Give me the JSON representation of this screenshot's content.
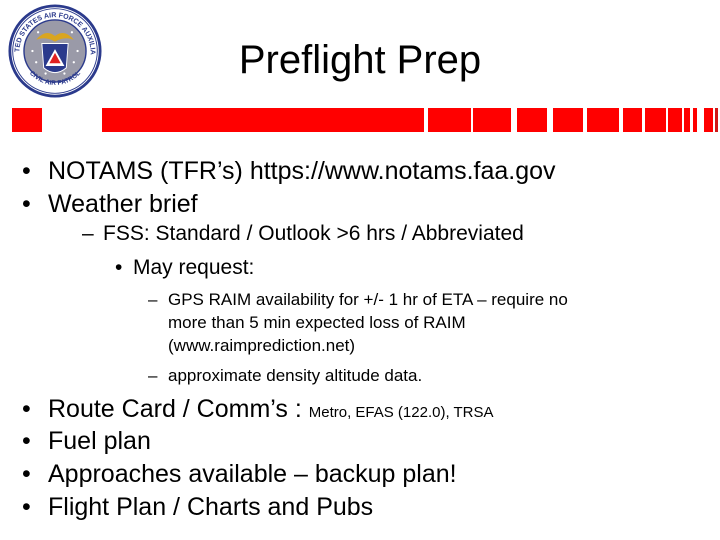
{
  "slide": {
    "title": "Preflight Prep",
    "logo": {
      "icon": "civil-air-patrol-seal-icon",
      "ring_top_text": "UNITED STATES AIR FORCE AUXILIARY",
      "ring_bottom_text": "CIVIL AIR PATROL"
    },
    "accent_color": "#ff0000",
    "bullets_top": [
      {
        "marker": "•",
        "text": "NOTAMS (TFR’s) https://www.notams.faa.gov"
      },
      {
        "marker": "•",
        "text": "Weather brief"
      }
    ],
    "weather_sub": {
      "marker": "–",
      "text": "FSS: Standard / Outlook >6 hrs / Abbreviated",
      "sub": {
        "marker": "•",
        "text": "May request:",
        "items": [
          {
            "marker": "–",
            "lines": [
              "GPS RAIM availability for +/- 1 hr of ETA – require no",
              "more than 5 min expected loss of RAIM",
              "(www.raimprediction.net)"
            ]
          },
          {
            "marker": "–",
            "lines": [
              "approximate density altitude data."
            ]
          }
        ]
      }
    },
    "bullets_bottom": [
      {
        "marker": "•",
        "text": "Route Card  / Comm’s : ",
        "small": "Metro, EFAS (122.0), TRSA"
      },
      {
        "marker": "•",
        "text": "Fuel plan"
      },
      {
        "marker": "•",
        "text": "Approaches available – backup plan!"
      },
      {
        "marker": "•",
        "text": "Flight Plan / Charts and Pubs"
      }
    ]
  }
}
